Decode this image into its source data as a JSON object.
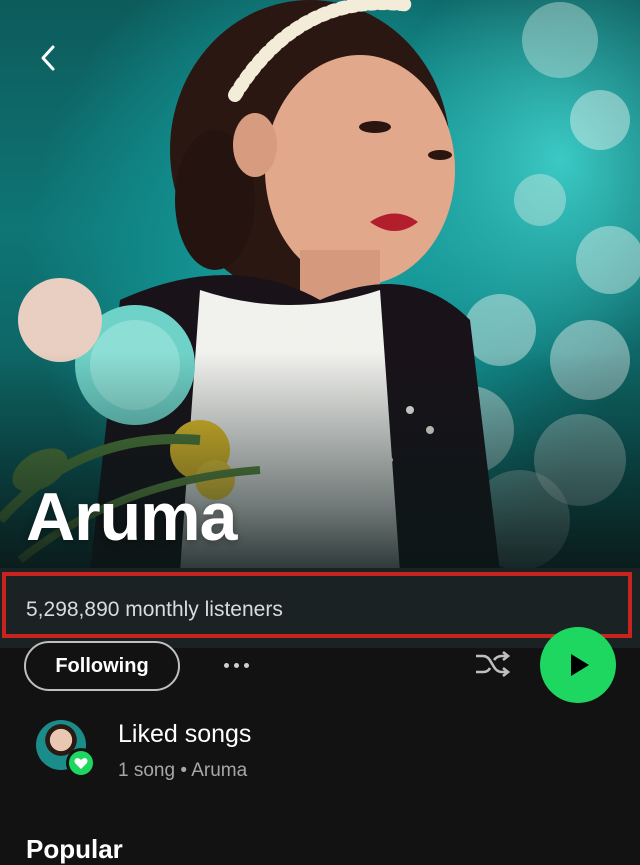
{
  "header": {
    "back_icon": "chevron-left-icon"
  },
  "artist": {
    "name": "Aruma",
    "monthly_listeners": "5,298,890 monthly listeners"
  },
  "controls": {
    "follow_label": "Following",
    "more_icon": "more-dots-icon",
    "shuffle_icon": "shuffle-icon",
    "play_icon": "play-icon"
  },
  "liked": {
    "title": "Liked songs",
    "subtitle": "1 song • Aruma",
    "badge_icon": "heart-icon"
  },
  "sections": {
    "popular_title": "Popular"
  },
  "colors": {
    "accent": "#1ed760",
    "background": "#121212",
    "highlight_border": "#c8241f"
  }
}
